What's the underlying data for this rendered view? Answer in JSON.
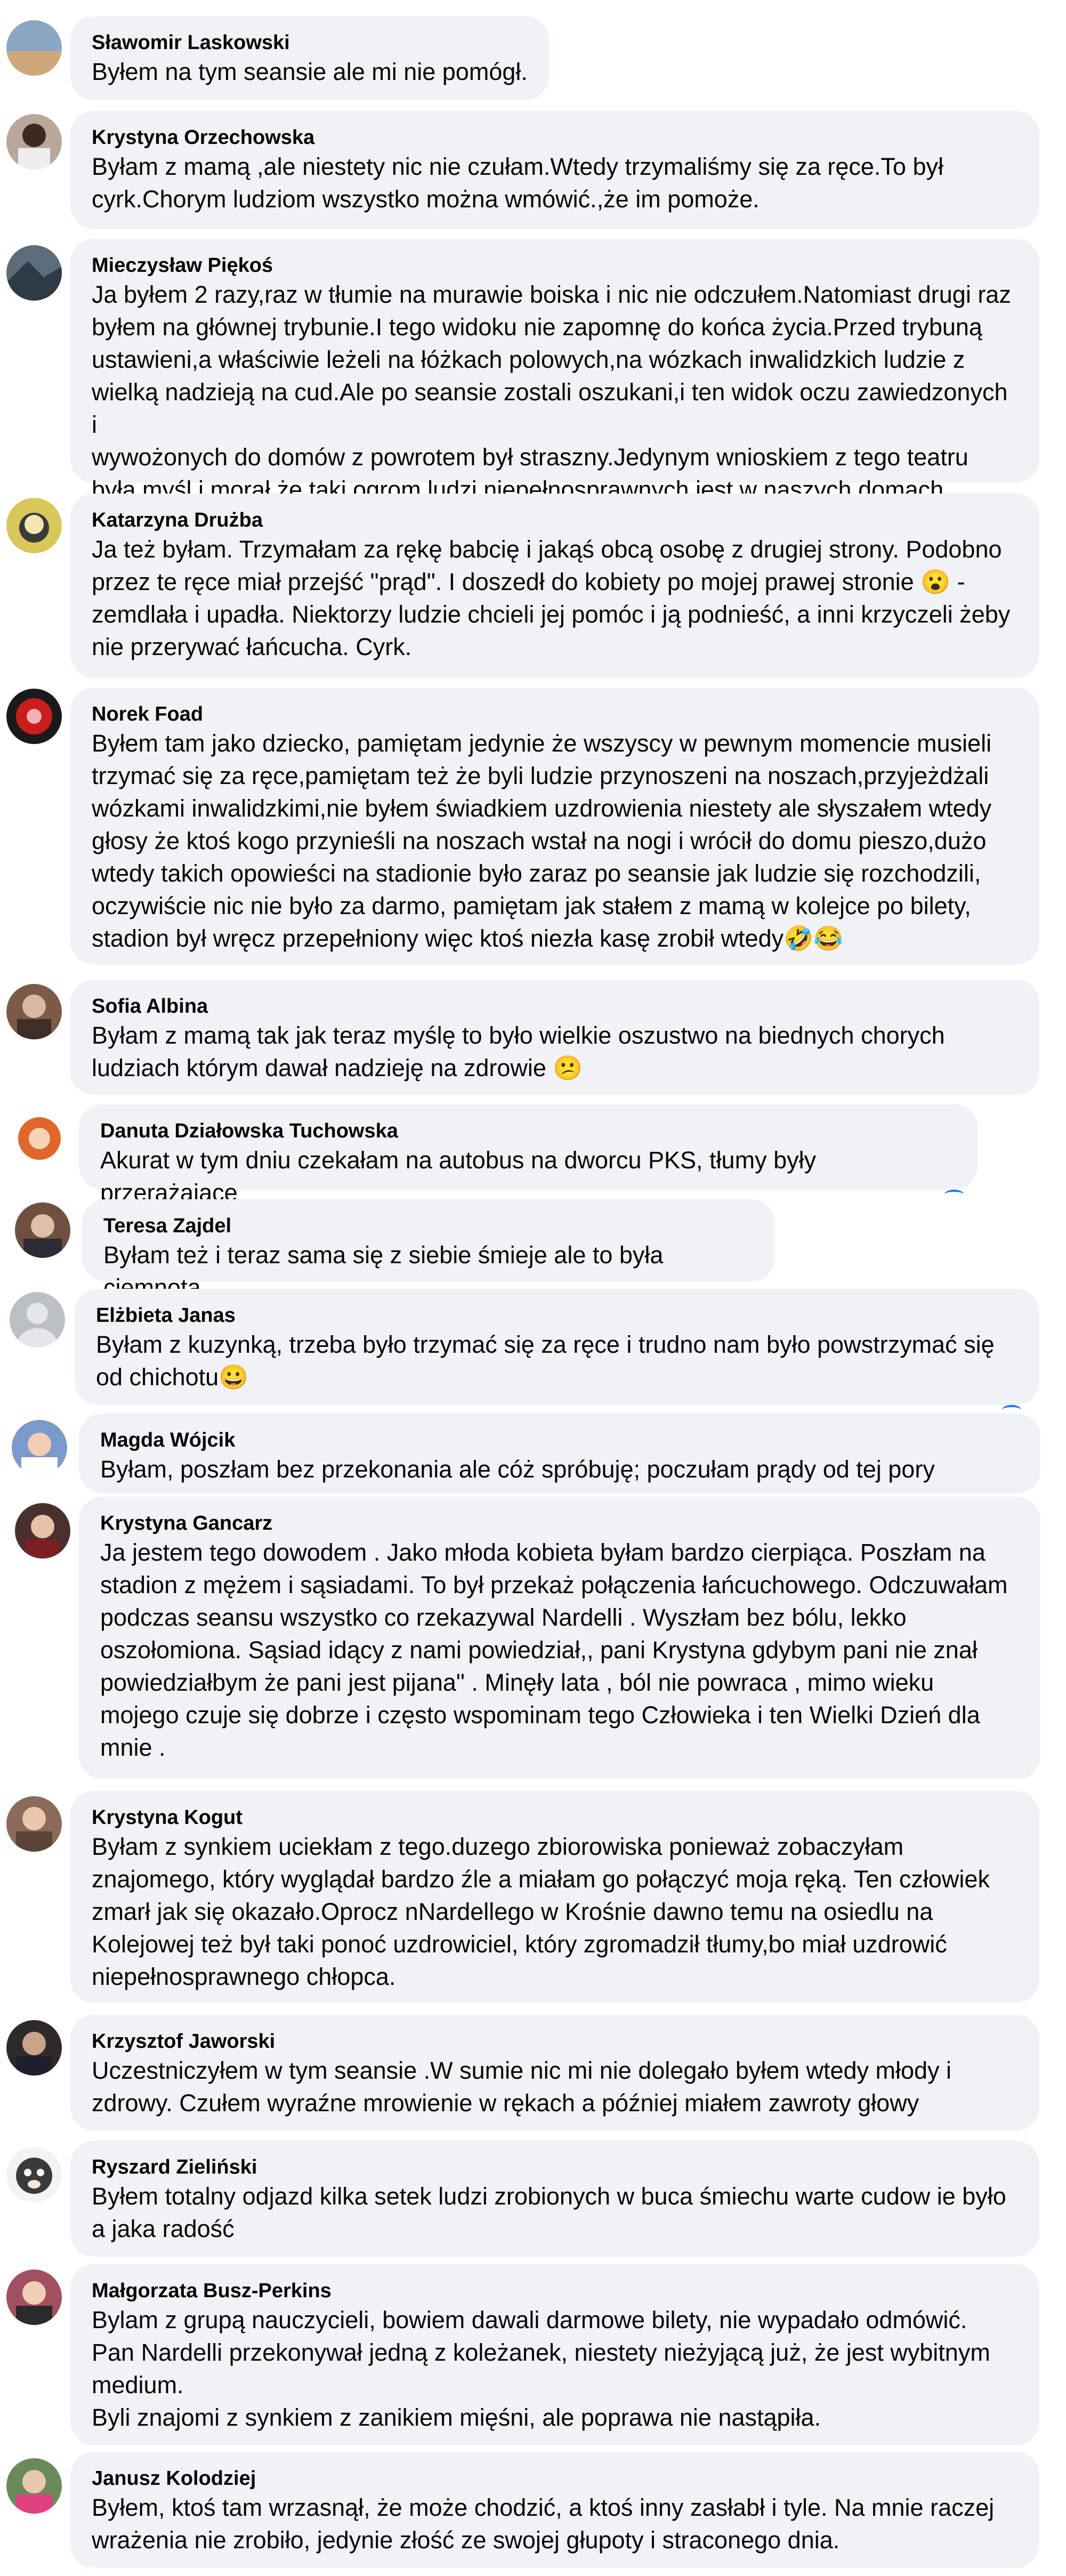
{
  "comments": [
    {
      "author": "Sławomir Laskowski",
      "lines": [
        "Byłem na tym seansie ale mi nie pomógł."
      ]
    },
    {
      "author": "Krystyna Orzechowska",
      "lines": [
        "Byłam z mamą ,ale niestety nic nie czułam.Wtedy trzymaliśmy się za ręce.To był",
        "cyrk.Chorym ludziom wszystko można wmówić.,że im pomoże."
      ]
    },
    {
      "author": "Mieczysław Piękoś",
      "lines": [
        "Ja byłem 2 razy,raz w tłumie na murawie boiska i nic nie odczułem.Natomiast drugi raz",
        "byłem na głównej trybunie.I tego widoku nie zapomnę do końca życia.Przed trybuną",
        "ustawieni,a właściwie leżeli na łóżkach polowych,na wózkach inwalidzkich ludzie z",
        "wielką nadzieją na cud.Ale po seansie zostali oszukani,i ten widok oczu zawiedzonych i",
        "wywożonych do domów z powrotem był straszny.Jedynym wnioskiem z tego teatru",
        "była myśl i morał,że taki ogrom ludzi niepełnosprawnych jest w naszych domach."
      ]
    },
    {
      "author": "Katarzyna Drużba",
      "lines": [
        "Ja też byłam. Trzymałam za rękę babcię i jakąś obcą osobę z drugiej strony. Podobno",
        "przez te ręce miał przejść \"prąd\". I doszedł do kobiety po mojej prawej stronie 😮 -",
        "zemdlała i upadła. Niektorzy ludzie chcieli jej pomóc i ją podnieść, a inni krzyczeli żeby",
        "nie przerywać łańcucha. Cyrk."
      ]
    },
    {
      "author": "Norek Foad",
      "lines": [
        "Byłem tam jako dziecko, pamiętam jedynie że wszyscy w pewnym momencie musieli",
        "trzymać się za ręce,pamiętam też że byli ludzie przynoszeni na noszach,przyjeżdżali",
        "wózkami inwalidzkimi,nie byłem świadkiem uzdrowienia niestety ale słyszałem wtedy",
        "głosy że ktoś kogo przynieśli na noszach wstał na nogi i wrócił do domu pieszo,dużo",
        "wtedy takich opowieści na stadionie było zaraz po seansie jak ludzie się rozchodzili,",
        "oczywiście nic nie było za darmo, pamiętam jak stałem z mamą w kolejce po bilety,",
        "stadion był wręcz przepełniony więc ktoś niezła kasę zrobił wtedy🤣😂"
      ]
    },
    {
      "author": "Sofia Albina",
      "lines": [
        "Byłam z mamą tak jak teraz myślę to było wielkie oszustwo na biednych chorych",
        "ludziach którym dawał nadzieję na zdrowie 😕"
      ]
    },
    {
      "author": "Danuta Działowska Tuchowska",
      "lines": [
        "Akurat w tym dniu czekałam na autobus na dworcu PKS, tłumy były przerażające"
      ]
    },
    {
      "author": "Teresa Zajdel",
      "lines": [
        "Byłam też i teraz sama się z siebie śmieje ale to była ciemnota"
      ]
    },
    {
      "author": "Elżbieta Janas",
      "lines": [
        "Byłam z kuzynką, trzeba było trzymać się za ręce i trudno nam było powstrzymać się",
        "od chichotu😀"
      ]
    },
    {
      "author": "Magda Wójcik",
      "lines": [
        "Byłam, poszłam bez przekonania ale cóż spróbuję; poczułam prądy od tej pory"
      ]
    },
    {
      "author": "Krystyna Gancarz",
      "lines": [
        "Ja jestem tego dowodem . Jako młoda kobieta byłam bardzo cierpiąca. Poszłam na",
        "stadion z mężem i sąsiadami. To był przekaż połączenia łańcuchowego. Odczuwałam",
        "podczas seansu wszystko co rzekazywal Nardelli . Wyszłam bez bólu, lekko",
        "oszołomiona. Sąsiad idący z nami powiedział,, pani Krystyna gdybym pani nie znał",
        "powiedziałbym że pani jest pijana\" . Minęły lata , ból nie powraca , mimo wieku",
        "mojego czuje się dobrze i często wspominam tego Człowieka i ten Wielki Dzień dla",
        "mnie ."
      ]
    },
    {
      "author": "Krystyna Kogut",
      "lines": [
        "Byłam z synkiem uciekłam z tego.duzego zbiorowiska ponieważ zobaczyłam",
        "znajomego, który wyglądał bardzo źle a miałam go połączyć moja ręką. Ten człowiek",
        "zmarł jak się okazało.Oprocz nNardellego w Krośnie dawno temu na osiedlu na",
        "Kolejowej też był taki ponoć uzdrowiciel, który zgromadził tłumy,bo miał uzdrowić",
        "niepełnosprawnego chłopca."
      ]
    },
    {
      "author": "Krzysztof Jaworski",
      "lines": [
        "Uczestniczyłem w tym seansie .W sumie nic mi nie dolegało byłem wtedy młody i",
        "zdrowy. Czułem wyraźne mrowienie w rękach a później miałem zawroty głowy"
      ]
    },
    {
      "author": "Ryszard Zieliński",
      "lines": [
        "Byłem totalny odjazd kilka setek ludzi zrobionych w buca śmiechu warte cudow ie było",
        "a jaka radość"
      ]
    },
    {
      "author": "Małgorzata Busz-Perkins",
      "lines": [
        "Bylam z grupą nauczycieli, bowiem dawali darmowe bilety, nie wypadało odmówić.",
        "Pan Nardelli przekonywał jedną z koleżanek, niestety nieżyjącą już, że jest wybitnym",
        "medium.",
        "Byli znajomi z synkiem z zanikiem mięśni, ale poprawa nie nastąpiła."
      ]
    },
    {
      "author": "Janusz Kolodziej",
      "lines": [
        "Byłem, ktoś tam wrzasnął, że może chodzić, a ktoś inny zasłabł i tyle. Na mnie raczej",
        "wrażenia nie zrobiło, jedynie złość ze swojej głupoty i straconego dnia."
      ]
    }
  ],
  "avatars": [
    {
      "icon": "avatar-photo-icon",
      "color": "#8aa7c4"
    },
    {
      "icon": "avatar-photo-icon",
      "color": "#b9a79a"
    },
    {
      "icon": "avatar-photo-icon",
      "color": "#5b6c7a"
    },
    {
      "icon": "avatar-photo-icon",
      "color": "#d8c85a"
    },
    {
      "icon": "avatar-photo-icon",
      "color": "#c81e1e"
    },
    {
      "icon": "avatar-photo-icon",
      "color": "#7b5a48"
    },
    {
      "icon": "avatar-photo-icon",
      "color": "#e0672c"
    },
    {
      "icon": "avatar-photo-icon",
      "color": "#6e5040"
    },
    {
      "icon": "default-avatar-icon",
      "color": "#bcc0c4"
    },
    {
      "icon": "avatar-photo-icon",
      "color": "#7c9ac9"
    },
    {
      "icon": "avatar-photo-icon",
      "color": "#4a2f2f"
    },
    {
      "icon": "avatar-photo-icon",
      "color": "#8a6a5a"
    },
    {
      "icon": "avatar-photo-icon",
      "color": "#2e2a2a"
    },
    {
      "icon": "avatar-photo-icon",
      "color": "#3a3a3a"
    },
    {
      "icon": "avatar-photo-icon",
      "color": "#a05060"
    },
    {
      "icon": "avatar-photo-icon",
      "color": "#6a8a5a"
    }
  ]
}
